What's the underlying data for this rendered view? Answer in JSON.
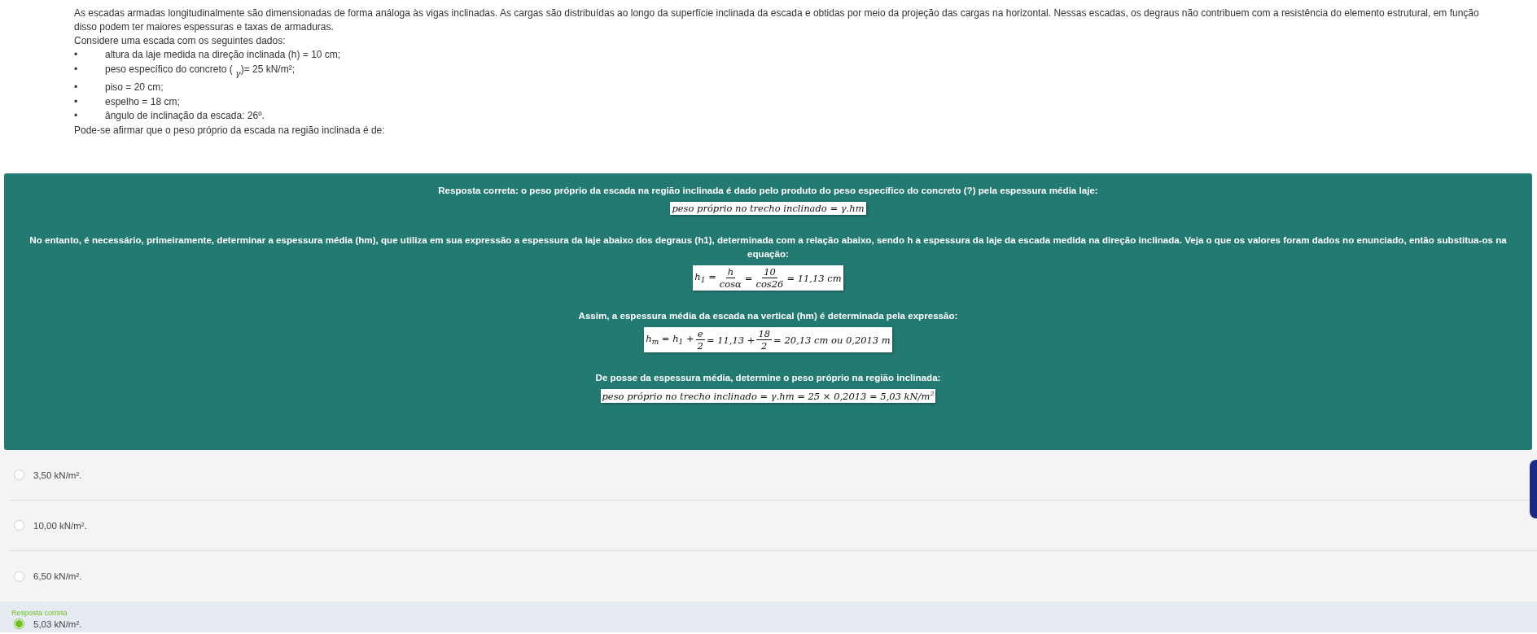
{
  "question": {
    "intro": [
      "As escadas armadas longitudinalmente são dimensionadas de forma análoga às vigas inclinadas. As cargas são distribuídas ao longo da superfície inclinada da escada e obtidas por meio da projeção das cargas na horizontal. Nessas escadas, os degraus não contribuem com a resistência do elemento estrutural, em função disso podem ter maiores espessuras e taxas de armaduras.",
      "Considere uma escada com os seguintes dados:"
    ],
    "bullets": [
      {
        "bullet": "•",
        "text": "altura da laje medida na direção inclinada (h) = 10 cm;"
      },
      {
        "bullet": "•",
        "text": "peso específico do concreto ( $_{γ}$)= 25 kN/m²;"
      },
      {
        "bullet": "•",
        "text": "piso = 20 cm;"
      },
      {
        "bullet": "•",
        "text": "espelho = 18 cm;"
      },
      {
        "bullet": "•",
        "text": "ângulo de inclinação da escada: 26º."
      }
    ],
    "closing": "Pode-se afirmar que o peso próprio da escada na região inclinada é de:"
  },
  "feedback": [
    {
      "kind": "text",
      "text": "Resposta correta: o peso próprio da escada na região inclinada é dado pelo produto do peso específico do concreto (?) pela espessura média laje:"
    },
    {
      "kind": "formula",
      "parts": [
        {
          "kind": "text",
          "text": "peso próprio no trecho inclinado = γ.hm"
        }
      ]
    },
    {
      "kind": "text",
      "text": "No entanto, é necessário, primeiramente, determinar a espessura média (hm), que utiliza em sua expressão a espessura da laje abaixo dos degraus (h1), determinada com a relação abaixo, sendo h a espessura da laje da escada medida na direção inclinada. Veja o que os valores foram dados no enunciado, então substitua-os na equação:"
    },
    {
      "kind": "formula",
      "parts": [
        {
          "kind": "text",
          "text": "h$_{1}$ = "
        },
        {
          "kind": "frac",
          "num": "h",
          "den": "cosα"
        },
        {
          "kind": "text",
          "text": " = "
        },
        {
          "kind": "frac",
          "num": "10",
          "den": "cos26"
        },
        {
          "kind": "text",
          "text": " = 11,13 cm"
        }
      ]
    },
    {
      "kind": "text",
      "text": "Assim, a espessura média da escada na vertical (hm) é determinada pela expressão:"
    },
    {
      "kind": "formula",
      "parts": [
        {
          "kind": "text",
          "text": "h$_{m}$ = h$_{1}$ + "
        },
        {
          "kind": "frac",
          "num": "e",
          "den": "2"
        },
        {
          "kind": "text",
          "text": " = 11,13 + "
        },
        {
          "kind": "frac",
          "num": "18",
          "den": "2"
        },
        {
          "kind": "text",
          "text": " = 20,13 cm ou 0,2013 m"
        }
      ]
    },
    {
      "kind": "text",
      "text": "De posse da espessura média, determine o peso próprio na região inclinada:"
    },
    {
      "kind": "formula",
      "parts": [
        {
          "kind": "text",
          "text": "peso próprio no trecho inclinado = γ.hm = 25 × 0,2013 = 5,03 kN/m$^{2}$"
        }
      ]
    }
  ],
  "options": [
    {
      "text": "3,50 kN/m².",
      "selected": false
    },
    {
      "text": "10,00 kN/m².",
      "selected": false
    },
    {
      "text": "6,50 kN/m².",
      "selected": false
    },
    {
      "text": "5,03 kN/m².",
      "selected": true,
      "label": "Resposta correta"
    }
  ]
}
